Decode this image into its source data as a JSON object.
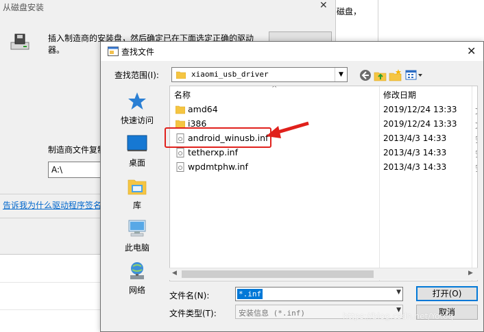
{
  "background_dialog": {
    "title": "从磁盘安装",
    "close_glyph": "✕",
    "instruction_line1": "插入制造商的安装盘，然后确定已在下面选定正确的驱动",
    "instruction_line2": "器。",
    "manufacturer_label": "制造商文件复制",
    "manufacturer_path": "A:\\",
    "help_link": "告诉我为什么驱动程序签名"
  },
  "background_window2": {
    "text": "磁盘，"
  },
  "dialog": {
    "title": "查找文件",
    "close_glyph": "✕",
    "lookin_label": "查找范围(I):",
    "lookin_value": "xiaomi_usb_driver",
    "places": [
      {
        "label": "快速访问",
        "icon": "star-icon"
      },
      {
        "label": "桌面",
        "icon": "desktop-icon"
      },
      {
        "label": "库",
        "icon": "library-icon"
      },
      {
        "label": "此电脑",
        "icon": "computer-icon"
      },
      {
        "label": "网络",
        "icon": "network-icon"
      }
    ],
    "columns": {
      "name": "名称",
      "modified": "修改日期"
    },
    "files": [
      {
        "name": "amd64",
        "date": "2019/12/24 13:33",
        "type": "folder",
        "extra": "文"
      },
      {
        "name": "i386",
        "date": "2019/12/24 13:33",
        "type": "folder",
        "extra": "文"
      },
      {
        "name": "android_winusb.inf",
        "date": "2013/4/3 14:33",
        "type": "inf",
        "extra": "安"
      },
      {
        "name": "tetherxp.inf",
        "date": "2013/4/3 14:33",
        "type": "inf",
        "extra": "安"
      },
      {
        "name": "wpdmtphw.inf",
        "date": "2013/4/3 14:33",
        "type": "inf",
        "extra": "安"
      }
    ],
    "filename_label": "文件名(N):",
    "filename_value": "*.inf",
    "filetype_label": "文件类型(T):",
    "filetype_value": "安装信息 (*.inf)",
    "open_button": "打开(O)",
    "cancel_button": "取消"
  },
  "watermark": "https://blog.csdn.net/Yotoq",
  "colors": {
    "annotation": "#e0201b",
    "selection": "#0078d7",
    "accent": "#0078d7"
  }
}
